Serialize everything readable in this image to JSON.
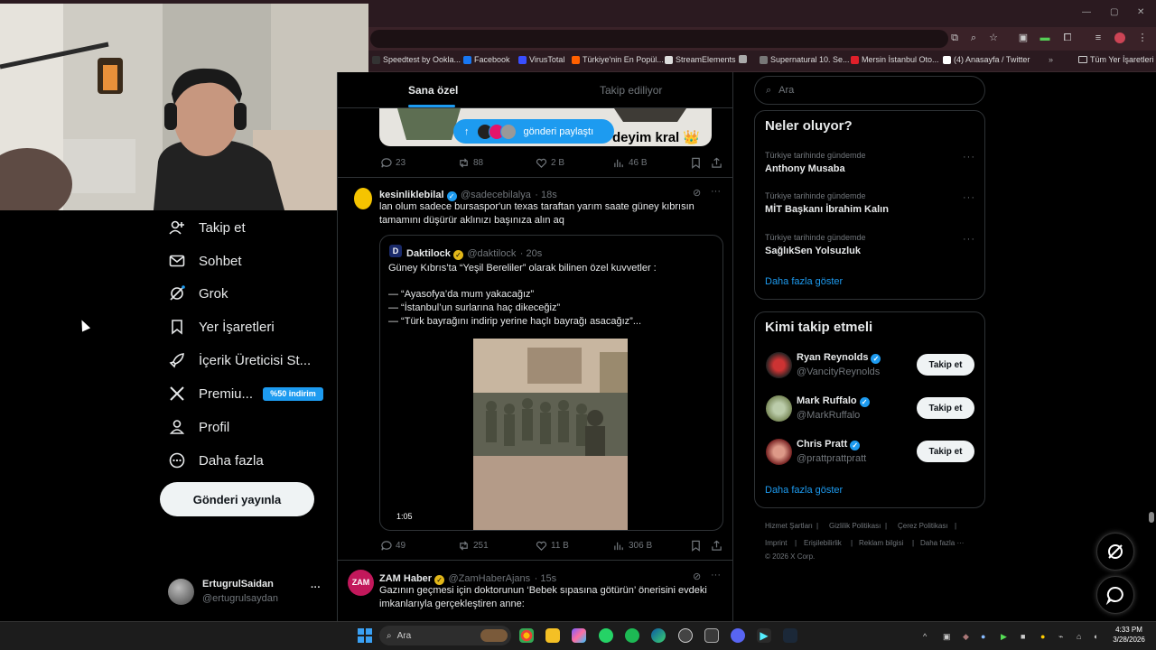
{
  "browser": {
    "bookmarks": [
      {
        "label": "Speedtest by Ookla...",
        "color": "#333"
      },
      {
        "label": "Facebook",
        "color": "#1877f2"
      },
      {
        "label": "VirusTotal",
        "color": "#394eff"
      },
      {
        "label": "Türkiye'nin En Popül...",
        "color": "#ff6000"
      },
      {
        "label": "StreamElements",
        "color": "#ddd"
      },
      {
        "label": "",
        "color": "#aaa"
      },
      {
        "label": "Supernatural 10. Se...",
        "color": "#777"
      },
      {
        "label": "Mersin İstanbul Oto...",
        "color": "#e0202a"
      },
      {
        "label": "(4) Anasayfa / Twitter",
        "color": "#fff"
      }
    ],
    "all_bookmarks": "Tüm Yer İşaretleri"
  },
  "nav": {
    "items": [
      {
        "label": "Takip et",
        "icon": "add-user-icon"
      },
      {
        "label": "Sohbet",
        "icon": "envelope-icon"
      },
      {
        "label": "Grok",
        "icon": "grok-icon"
      },
      {
        "label": "Yer İşaretleri",
        "icon": "bookmark-icon"
      },
      {
        "label": "İçerik Üreticisi St...",
        "icon": "rocket-icon"
      },
      {
        "label": "Premiu...",
        "icon": "x-logo-icon"
      },
      {
        "label": "Profil",
        "icon": "person-icon"
      },
      {
        "label": "Daha fazla",
        "icon": "more-circle-icon"
      }
    ],
    "premium_badge": "%50 indirim",
    "post_button": "Gönderi yayınla",
    "account": {
      "name": "ErtugrulSaidan",
      "handle": "@ertugrulsaydan",
      "more": "···"
    }
  },
  "tabs": {
    "for_you": "Sana özel",
    "following": "Takip ediliyor"
  },
  "share_pill": {
    "label": "gönderi paylaştı"
  },
  "tweet0": {
    "image_caption": "deyim kral 👑",
    "replies": "23",
    "reposts": "88",
    "likes": "2 B",
    "views": "46 B"
  },
  "tweet1": {
    "name": "kesinliklebilal",
    "handle": "@sadecebilalya",
    "time": "· 18s",
    "text": "lan olum sadece bursaspor'un texas taraftan yarım saate güney kıbrısın tamamını düşürür aklınızı başınıza alın aq",
    "quote": {
      "name": "Daktilock",
      "handle": "@daktilock",
      "time": "· 20s",
      "lines": [
        "Güney Kıbrıs’ta “Yeşil Bereliler” olarak bilinen özel kuvvetler :",
        "",
        "— “Ayasofya’da mum yakacağız”",
        "— “İstanbul’un surlarına haç dikeceğiz”",
        "— “Türk bayrağını indirip yerine haçlı bayrağı asacağız”..."
      ],
      "video_duration": "1:05"
    },
    "replies": "49",
    "reposts": "251",
    "likes": "11 B",
    "views": "306 B"
  },
  "tweet2": {
    "name": "ZAM Haber",
    "handle": "@ZamHaberAjans",
    "time": "· 15s",
    "avatar_text": "ZAM",
    "text": "Gazının geçmesi için doktorunun ‘Bebek sıpasına götürün’ önerisini evdeki imkanlarıyla gerçekleştiren anne:"
  },
  "right": {
    "search_placeholder": "Ara",
    "trends_title": "Neler oluyor?",
    "trends": [
      {
        "meta": "Türkiye tarihinde gündemde",
        "name": "Anthony Musaba"
      },
      {
        "meta": "Türkiye tarihinde gündemde",
        "name": "MİT Başkanı İbrahim Kalın"
      },
      {
        "meta": "Türkiye tarihinde gündemde",
        "name": "SağlıkSen Yolsuzluk"
      }
    ],
    "show_more": "Daha fazla göster",
    "wtf_title": "Kimi takip etmeli",
    "wtf": [
      {
        "name": "Ryan Reynolds",
        "handle": "@VancityReynolds",
        "button": "Takip et"
      },
      {
        "name": "Mark Ruffalo",
        "handle": "@MarkRuffalo",
        "button": "Takip et"
      },
      {
        "name": "Chris Pratt",
        "handle": "@prattprattpratt",
        "button": "Takip et"
      }
    ],
    "footer": [
      "Hizmet Şartları",
      "|",
      "Gizlilik Politikası",
      "|",
      "Çerez Politikası",
      "|",
      "Imprint",
      "|",
      "Erişilebilirlik",
      "|",
      "Reklam bilgisi",
      "|",
      "Daha fazla ···",
      "© 2026 X Corp."
    ]
  },
  "taskbar": {
    "search": "Ara",
    "time": "4:33 PM",
    "date": "3/28/2026"
  }
}
